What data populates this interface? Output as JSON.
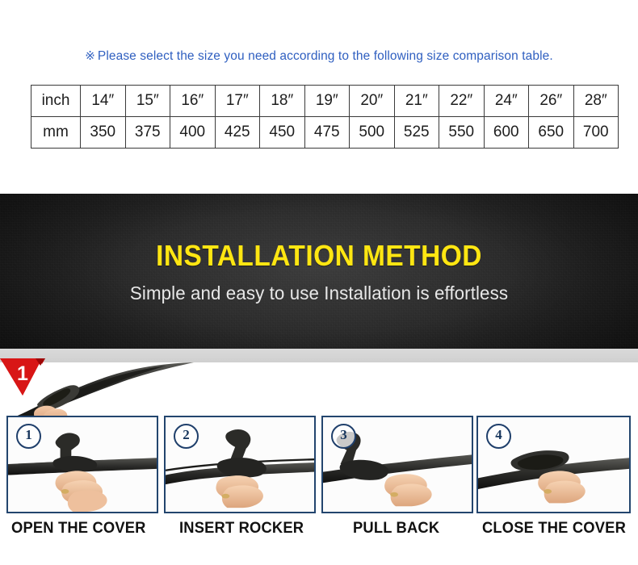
{
  "size_section": {
    "note_mark": "※",
    "note_text": "Please select the size you need according to the following size comparison table.",
    "note_color": "#2f5fc0",
    "table": {
      "row_headers": [
        "inch",
        "mm"
      ],
      "inch_values": [
        "14″",
        "15″",
        "16″",
        "17″",
        "18″",
        "19″",
        "20″",
        "21″",
        "22″",
        "24″",
        "26″",
        "28″"
      ],
      "mm_values": [
        "350",
        "375",
        "400",
        "425",
        "450",
        "475",
        "500",
        "525",
        "550",
        "600",
        "650",
        "700"
      ]
    }
  },
  "banner": {
    "title": "INSTALLATION METHOD",
    "subtitle": "Simple and easy to use Installation is effortless",
    "title_color": "#ffe612",
    "subtitle_color": "#e8e8e8",
    "background_color": "#262626"
  },
  "hero": {
    "ribbon_number": "1",
    "ribbon_color": "#d00b0b",
    "strip_color": "#d5d5d5",
    "blade_image_name": "wiper-blade-in-hand-photo"
  },
  "steps": {
    "border_color": "#23456e",
    "items": [
      {
        "badge": "①",
        "number": "1",
        "label": "OPEN THE COVER",
        "art_name": "hand-opening-wiper-cover-photo"
      },
      {
        "badge": "②",
        "number": "2",
        "label": "INSERT ROCKER",
        "art_name": "hand-inserting-rocker-photo"
      },
      {
        "badge": "③",
        "number": "3",
        "label": "PULL BACK",
        "art_name": "hand-pulling-back-blade-photo"
      },
      {
        "badge": "④",
        "number": "4",
        "label": "CLOSE THE COVER",
        "art_name": "hand-closing-cover-photo"
      }
    ]
  }
}
